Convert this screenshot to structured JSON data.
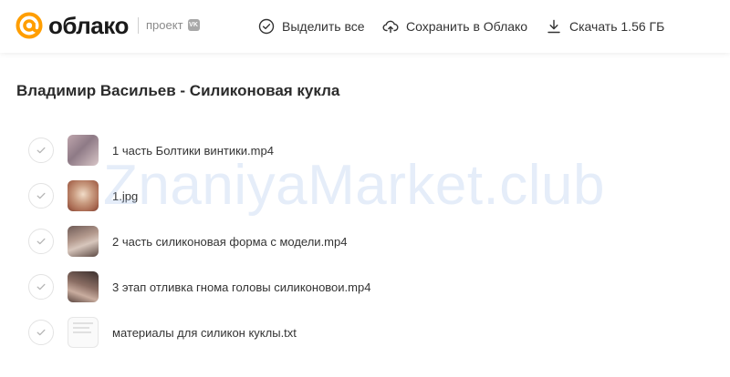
{
  "header": {
    "logo_text": "облако",
    "project_label": "проект",
    "vk_badge": "VK",
    "select_all_label": "Выделить все",
    "save_label": "Сохранить в Облако",
    "download_label": "Скачать 1.56 ГБ"
  },
  "colors": {
    "brand_orange": "#ff9e00",
    "text_primary": "#333333",
    "text_muted": "#8a8a8a"
  },
  "folder": {
    "title": "Владимир Васильев - Силиконовая кукла"
  },
  "files": [
    {
      "name": "1 часть Болтики винтики.mp4",
      "type": "video"
    },
    {
      "name": "1.jpg",
      "type": "image"
    },
    {
      "name": "2 часть силиконовая форма с модели.mp4",
      "type": "video"
    },
    {
      "name": "3 этап отливка гнома головы силиконовои.mp4",
      "type": "video"
    },
    {
      "name": "материалы для силикон куклы.txt",
      "type": "text"
    }
  ],
  "watermark": "ZnaniyaMarket.club"
}
